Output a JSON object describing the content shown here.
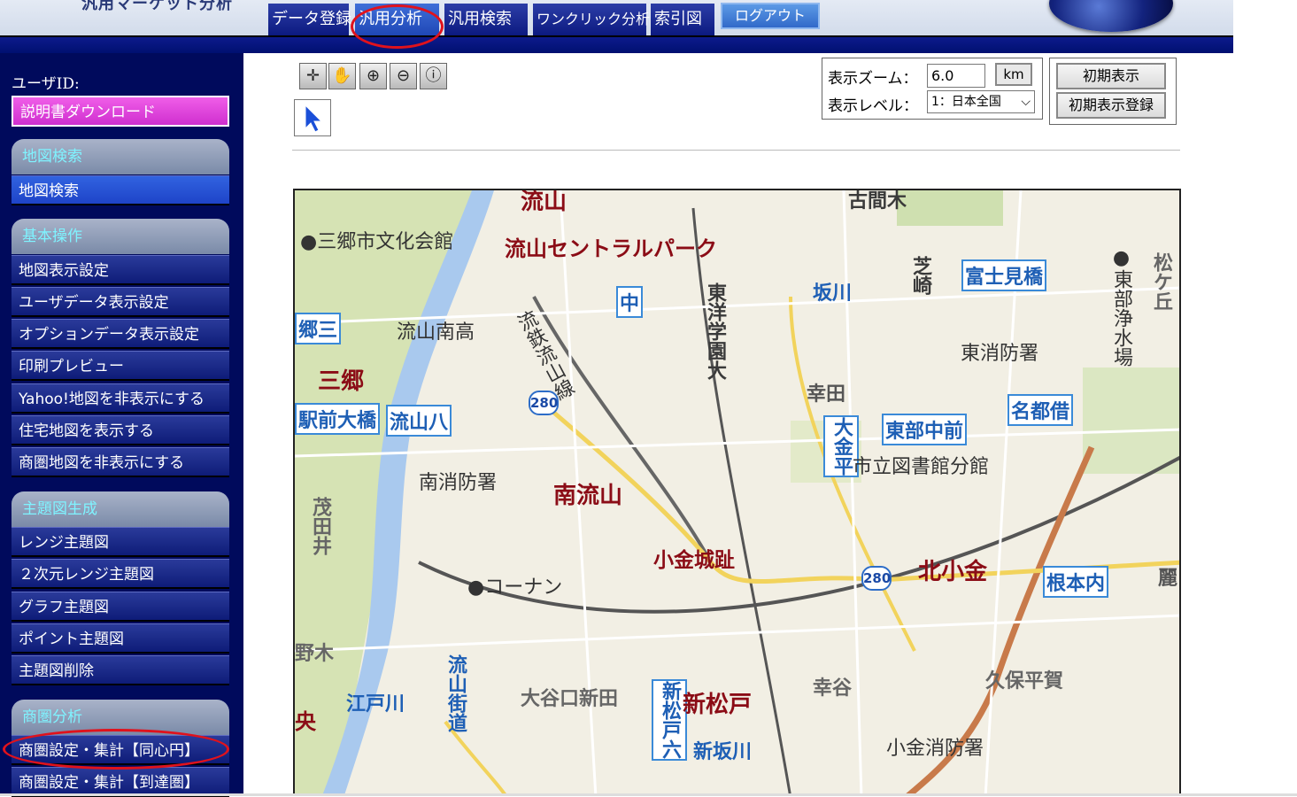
{
  "header": {
    "logo_text": "汎用マーケット分析",
    "tabs": [
      "データ登録",
      "汎用分析",
      "汎用検索",
      "ワンクリック分析",
      "索引図"
    ],
    "logout": "ログアウト"
  },
  "sidebar": {
    "user_id_label": "ユーザID:",
    "download": "説明書ダウンロード",
    "sections": [
      {
        "title": "地図検索",
        "items": [
          "地図検索"
        ]
      },
      {
        "title": "基本操作",
        "items": [
          "地図表示設定",
          "ユーザデータ表示設定",
          "オプションデータ表示設定",
          "印刷プレビュー",
          "Yahoo!地図を非表示にする",
          "住宅地図を表示する",
          "商圏地図を非表示にする"
        ]
      },
      {
        "title": "主題図生成",
        "items": [
          "レンジ主題図",
          "２次元レンジ主題図",
          "グラフ主題図",
          "ポイント主題図",
          "主題図削除"
        ]
      },
      {
        "title": "商圏分析",
        "items": [
          "商圏設定・集計【同心円】",
          "商圏設定・集計【到達圏】"
        ]
      }
    ]
  },
  "toolbar": {
    "zoom_label": "表示ズーム：",
    "zoom_value": "6.0",
    "km_label": "km",
    "level_label": "表示レベル：",
    "level_value": "1：日本全国",
    "initial_view": "初期表示",
    "initial_view_register": "初期表示登録"
  },
  "map": {
    "labels": {
      "komeg": "古間木",
      "nagareyama_top": "流山",
      "bunka": "●三郷市文化会館",
      "central_park": "流山セントラルパーク",
      "naka": "中",
      "toyo": "東洋学園大",
      "sakagawa": "坂川",
      "shiba": "芝崎",
      "fujimi": "富士見橋",
      "tobu_josui": "●東部浄水場",
      "matsuga": "松ケ丘",
      "gou3": "郷三",
      "minami_high": "流山南高",
      "rail": "流鉄流山線",
      "higashi_fire": "東消防署",
      "misato": "三郷",
      "saida": "幸田",
      "meito": "名都借",
      "tobu_naka": "東部中前",
      "ekimae": "駅前大橋",
      "nagareyama8": "流山八",
      "okane_taira": "大金平",
      "library": "市立図書館分館",
      "minami_fire": "南消防署",
      "minami_nagareyama": "南流山",
      "moda": "茂田井",
      "kogane_castle": "小金城趾",
      "kita_kogane": "北小金",
      "nebuuchi": "根本内",
      "kohnan": "●コーナン",
      "yano": "野木",
      "nagareyama_kaido": "流山街道",
      "edogawa": "江戸川",
      "oyaguchi": "大谷口新田",
      "shinmatsudo6": "新松戸六",
      "shinmatsudo": "新松戸",
      "kouya": "幸谷",
      "kubo": "久保平賀",
      "chuo": "央",
      "shinsakagawa": "新坂川",
      "kogane_fire": "小金消防署",
      "reki": "麗"
    },
    "route_number": "280"
  }
}
